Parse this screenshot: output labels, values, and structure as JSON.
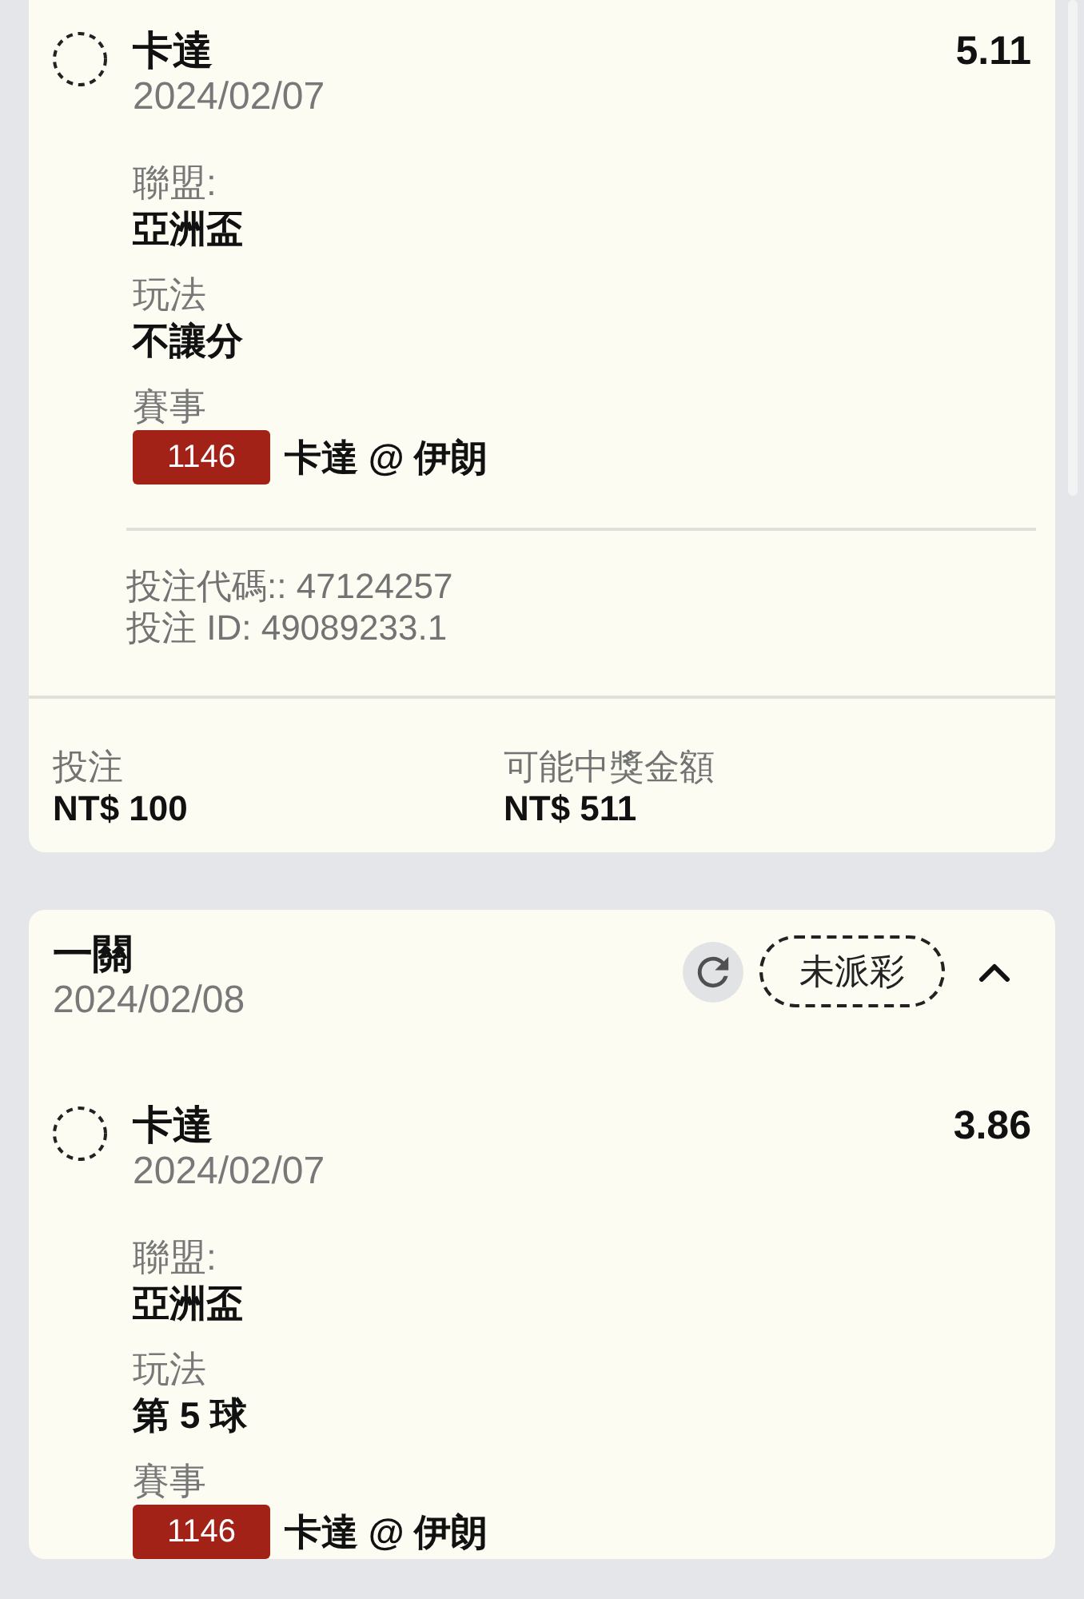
{
  "bets": [
    {
      "selections": [
        {
          "team": "卡達",
          "date": "2024/02/07",
          "odds": "5.11",
          "fields": [
            {
              "label": "聯盟:",
              "value": "亞洲盃"
            },
            {
              "label": "玩法",
              "value": "不讓分"
            }
          ],
          "event_label": "賽事",
          "event_code": "1146",
          "event_name": "卡達 @ 伊朗"
        }
      ],
      "codes": [
        "投注代碼:: 47124257",
        "投注 ID: 49089233.1"
      ],
      "summary": [
        {
          "label": "投注",
          "value": "NT$ 100"
        },
        {
          "label": "可能中獎金額",
          "value": "NT$ 511"
        }
      ]
    },
    {
      "header": {
        "title": "一關",
        "date": "2024/02/08",
        "status": "未派彩",
        "expanded": true
      },
      "selections": [
        {
          "team": "卡達",
          "date": "2024/02/07",
          "odds": "3.86",
          "fields": [
            {
              "label": "聯盟:",
              "value": "亞洲盃"
            },
            {
              "label": "玩法",
              "value": "第 5 球"
            }
          ],
          "event_label": "賽事",
          "event_code": "1146",
          "event_name": "卡達 @ 伊朗"
        }
      ]
    }
  ]
}
